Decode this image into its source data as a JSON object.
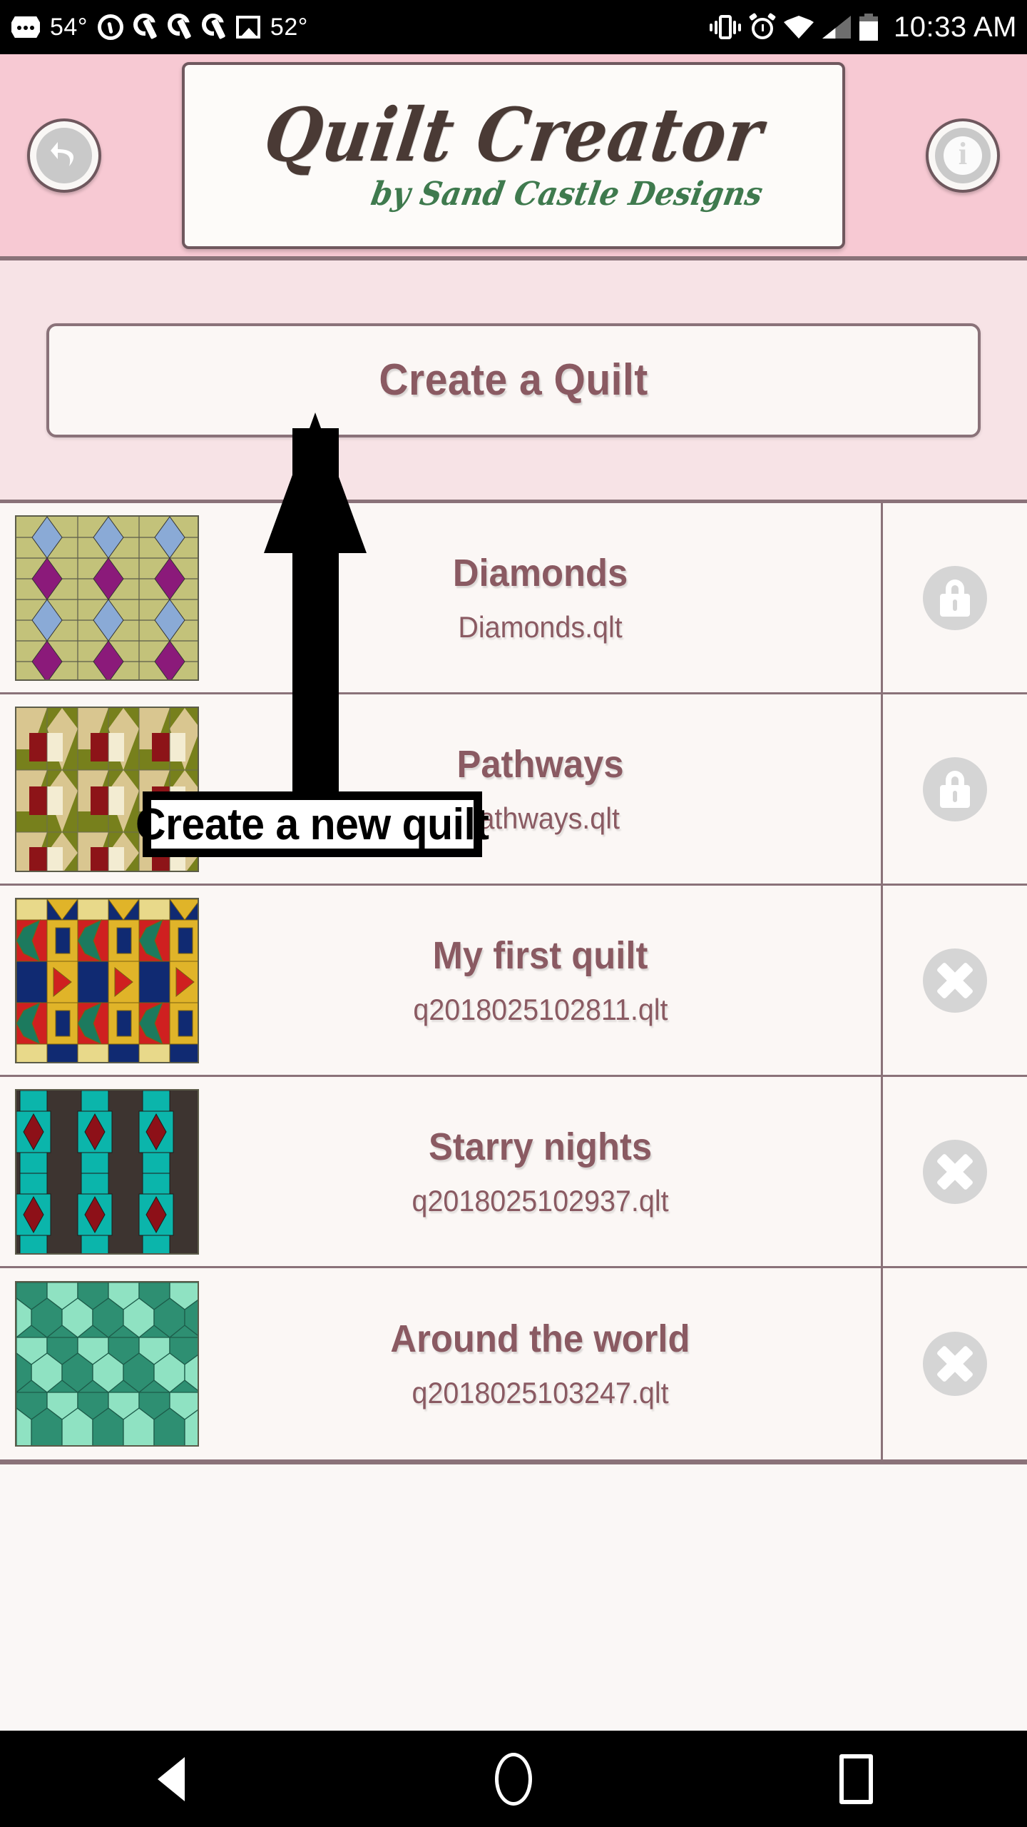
{
  "statusbar": {
    "temp_left": "54°",
    "temp_right": "52°",
    "time": "10:33 AM",
    "icons_left": [
      "more-dots-icon",
      "pinterest-icon",
      "wrench-icon",
      "wrench-icon",
      "wrench-icon",
      "photo-icon"
    ],
    "icons_right": [
      "vibrate-icon",
      "alarm-icon",
      "wifi-icon",
      "signal-icon",
      "battery-icon"
    ]
  },
  "appbar": {
    "back_button": "back-icon",
    "info_button": "info-icon",
    "logo_title": "Quilt Creator",
    "logo_subtitle": "by Sand Castle Designs",
    "bg_color": "#f7c9d3",
    "logo_title_color": "#4a3a35",
    "logo_subtitle_color": "#3f7a4e"
  },
  "create_panel": {
    "button_label": "Create a Quilt",
    "bg_color": "#f7e3e6",
    "text_color": "#8a5a62"
  },
  "annotation": {
    "label": "Create a new quilt",
    "arrow": "up-arrow",
    "color": "#000000"
  },
  "quilts": [
    {
      "title": "Diamonds",
      "file": "Diamonds.qlt",
      "action_icon": "lock-icon",
      "thumb": {
        "bg": "#c3c27a",
        "colors": [
          "#8b1a7a",
          "#8aaad6",
          "#c3c27a"
        ],
        "pattern": "diamonds"
      }
    },
    {
      "title": "Pathways",
      "file": "Pathways.qlt",
      "action_icon": "lock-icon",
      "thumb": {
        "bg": "#77801c",
        "colors": [
          "#8d1418",
          "#d9c690",
          "#f3ecd2",
          "#77801c"
        ],
        "pattern": "pathways"
      }
    },
    {
      "title": "My first quilt",
      "file": "q2018025102811.qlt",
      "action_icon": "delete-icon",
      "thumb": {
        "bg": "#e0b429",
        "colors": [
          "#102a72",
          "#cf2020",
          "#1c7a5e",
          "#e0b429",
          "#e8d98a"
        ],
        "pattern": "stars"
      }
    },
    {
      "title": "Starry nights",
      "file": "q2018025102937.qlt",
      "action_icon": "delete-icon",
      "thumb": {
        "bg": "#3d3430",
        "colors": [
          "#0bb5ab",
          "#8d1018",
          "#3d3430"
        ],
        "pattern": "starry"
      }
    },
    {
      "title": "Around the world",
      "file": "q2018025103247.qlt",
      "action_icon": "delete-icon",
      "thumb": {
        "bg": "#2e8f72",
        "colors": [
          "#8fe2c2",
          "#2e8f72"
        ],
        "pattern": "world"
      }
    }
  ],
  "navbar": {
    "back": "nav-back-icon",
    "home": "nav-home-icon",
    "recents": "nav-recents-icon"
  }
}
